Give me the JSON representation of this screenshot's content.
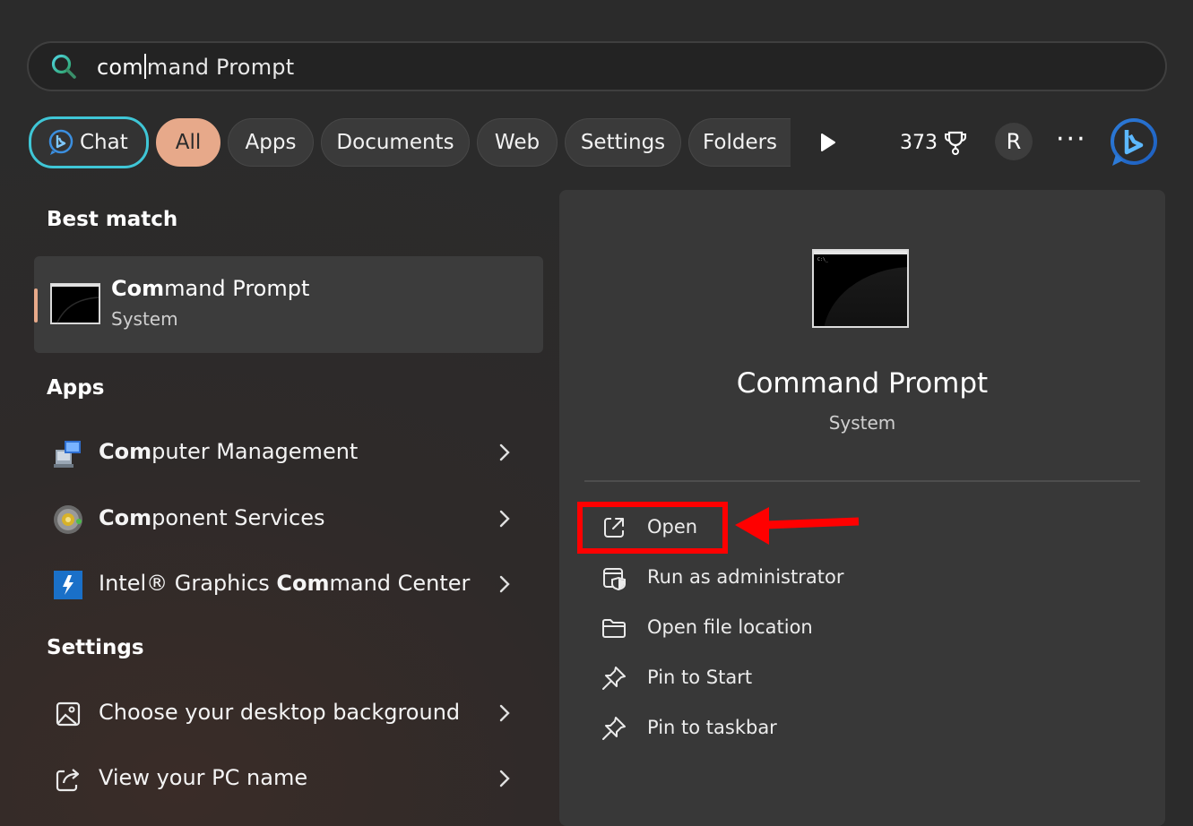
{
  "search": {
    "typed": "com",
    "rest": "mand Prompt"
  },
  "filters": {
    "chat": "Chat",
    "all": "All",
    "apps": "Apps",
    "documents": "Documents",
    "web": "Web",
    "settings": "Settings",
    "folders": "Folders"
  },
  "header": {
    "points": "373",
    "avatar_initial": "R",
    "more": "···"
  },
  "best_match": {
    "section": "Best match",
    "name_bold": "Com",
    "name_rest": "mand Prompt",
    "sub": "System"
  },
  "apps": {
    "section": "Apps",
    "items": [
      {
        "bold": "Com",
        "rest": "puter Management",
        "pre": ""
      },
      {
        "bold": "Com",
        "rest": "ponent Services",
        "pre": ""
      },
      {
        "pre": "Intel® Graphics ",
        "bold": "Com",
        "rest": "mand Center"
      }
    ]
  },
  "settings": {
    "section": "Settings",
    "items": [
      {
        "label": "Choose your desktop background"
      },
      {
        "label": "View your PC name"
      }
    ]
  },
  "detail": {
    "preview_text": "C:\\_",
    "title": "Command Prompt",
    "sub": "System",
    "actions": [
      {
        "label": "Open"
      },
      {
        "label": "Run as administrator"
      },
      {
        "label": "Open file location"
      },
      {
        "label": "Pin to Start"
      },
      {
        "label": "Pin to taskbar"
      }
    ]
  },
  "colors": {
    "accent_chip": "#e7a98a",
    "chat_border": "#3fc6d6",
    "highlight": "#ff0000"
  }
}
